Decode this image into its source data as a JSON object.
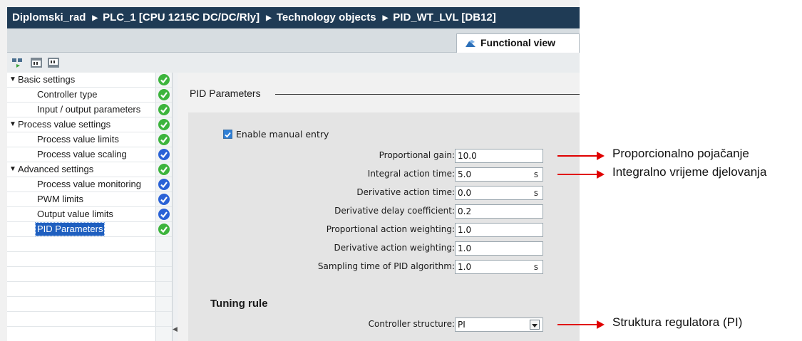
{
  "breadcrumb": {
    "segments": [
      "Diplomski_rad",
      "PLC_1 [CPU 1215C DC/DC/Rly]",
      "Technology objects",
      "PID_WT_LVL [DB12]"
    ],
    "separator": "▶"
  },
  "tabs": {
    "functional_view": "Functional view"
  },
  "toolbar": {
    "icons": [
      "monitor-icon",
      "expand-icon",
      "collapse-icon"
    ]
  },
  "tree": {
    "items": [
      {
        "label": "Basic settings",
        "status": "green"
      },
      {
        "label": "Controller type",
        "status": "green"
      },
      {
        "label": "Input / output parameters",
        "status": "green"
      },
      {
        "label": "Process value settings",
        "status": "green"
      },
      {
        "label": "Process value limits",
        "status": "green"
      },
      {
        "label": "Process value scaling",
        "status": "blue"
      },
      {
        "label": "Advanced settings",
        "status": "green"
      },
      {
        "label": "Process value monitoring",
        "status": "blue"
      },
      {
        "label": "PWM limits",
        "status": "blue"
      },
      {
        "label": "Output value limits",
        "status": "blue"
      },
      {
        "label": "PID Parameters",
        "status": "green"
      }
    ]
  },
  "content": {
    "section_title": "PID Parameters",
    "enable_label": "Enable manual entry",
    "enable_checked": true,
    "fields": [
      {
        "label": "Proportional gain:",
        "value": "10.0",
        "unit": ""
      },
      {
        "label": "Integral action time:",
        "value": "5.0",
        "unit": "s"
      },
      {
        "label": "Derivative action time:",
        "value": "0.0",
        "unit": "s"
      },
      {
        "label": "Derivative delay coefficient:",
        "value": "0.2",
        "unit": ""
      },
      {
        "label": "Proportional action weighting:",
        "value": "1.0",
        "unit": ""
      },
      {
        "label": "Derivative action weighting:",
        "value": "1.0",
        "unit": ""
      },
      {
        "label": "Sampling time of PID algorithm:",
        "value": "1.0",
        "unit": "s"
      }
    ],
    "tuning_title": "Tuning rule",
    "controller_structure_label": "Controller structure:",
    "controller_structure_value": "PI"
  },
  "annotations": {
    "p_gain": "Proporcionalno pojačanje",
    "i_time": "Integralno vrijeme djelovanja",
    "structure": "Struktura regulatora (PI)"
  },
  "colors": {
    "status_green": "#3cb43c",
    "status_blue": "#2a62d6",
    "arrow": "#e00000",
    "header": "#1f3b55"
  }
}
